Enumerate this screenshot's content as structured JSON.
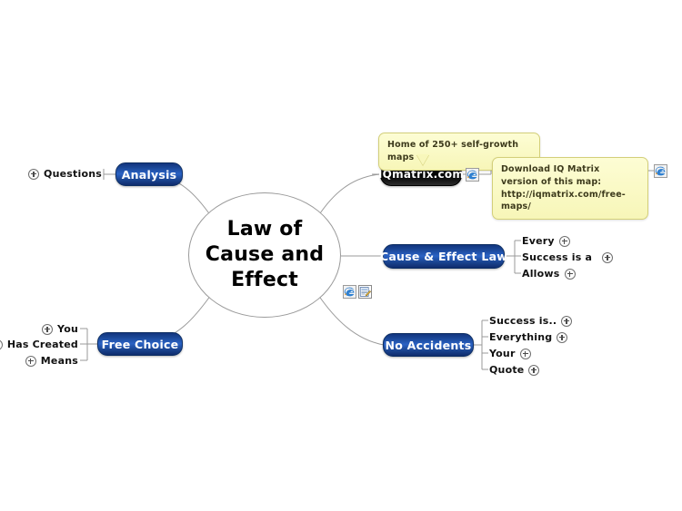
{
  "map": {
    "root": {
      "label": "Law of\nCause and\nEffect",
      "line1": "Law of",
      "line2": "Cause and",
      "line3": "Effect"
    },
    "colors": {
      "node_blue_top": "#12357e",
      "node_blue_mid": "#2a62c4",
      "node_blue_bottom": "#0f2c6d",
      "node_black": "#000000",
      "callout_yellow": "#f7f6b8",
      "callout_border": "#d3cf7a",
      "connector": "#9a9a9a",
      "canvas": "#ffffff"
    },
    "branches": {
      "analysis": {
        "label": "Analysis",
        "children": [
          {
            "label": "Questions",
            "expandable": true
          }
        ]
      },
      "free_choice": {
        "label": "Free Choice",
        "children": [
          {
            "label": "You",
            "expandable": true
          },
          {
            "label": "Has Created",
            "expandable": true
          },
          {
            "label": "Means",
            "expandable": true
          }
        ]
      },
      "iqmatrix": {
        "label": "IQmatrix.com",
        "callouts": [
          {
            "text": "Home of 250+ self-growth maps"
          },
          {
            "text": "Download IQ Matrix version of this map: http://iqmatrix.com/free-maps/"
          }
        ]
      },
      "cause_effect_law": {
        "label": "Cause & Effect Law",
        "children": [
          {
            "label": "Every",
            "expandable": true
          },
          {
            "label": "Success is a",
            "expandable": true
          },
          {
            "label": "Allows",
            "expandable": true
          }
        ]
      },
      "no_accidents": {
        "label": "No Accidents",
        "children": [
          {
            "label": "Success is..",
            "expandable": true
          },
          {
            "label": "Everything",
            "expandable": true
          },
          {
            "label": "Your",
            "expandable": true
          },
          {
            "label": "Quote",
            "expandable": true
          }
        ]
      }
    },
    "attachments": {
      "root_hyperlink": "internet-explorer-icon",
      "root_note": "note-icon",
      "iqmatrix_hyperlink": "internet-explorer-icon",
      "callout_hyperlink": "internet-explorer-icon"
    }
  }
}
